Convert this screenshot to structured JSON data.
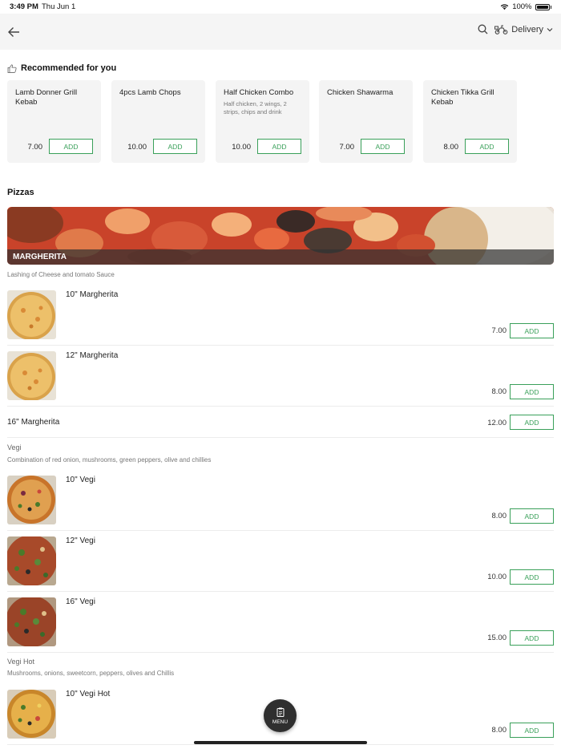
{
  "status_bar": {
    "time": "3:49 PM",
    "date": "Thu Jun 1",
    "battery": "100%"
  },
  "header": {
    "delivery_label": "Delivery"
  },
  "icons": {
    "back": "back-arrow-icon",
    "search": "search-icon",
    "delivery": "scooter-icon",
    "dropdown": "chevron-down-icon",
    "recommended": "thumbs-up-icon",
    "menu": "menu-clipboard-icon"
  },
  "colors": {
    "accent": "#3aa05a",
    "header_bg": "#f5f5f5",
    "card_bg": "#f4f4f4",
    "fab_bg": "#2f2f2f"
  },
  "recommended": {
    "title": "Recommended for you",
    "items": [
      {
        "name": "Lamb Donner Grill Kebab",
        "desc": "",
        "price": "7.00",
        "add": "ADD"
      },
      {
        "name": "4pcs Lamb Chops",
        "desc": "",
        "price": "10.00",
        "add": "ADD"
      },
      {
        "name": "Half Chicken Combo",
        "desc": "Half chicken, 2 wings, 2 strips, chips and drink",
        "price": "10.00",
        "add": "ADD"
      },
      {
        "name": "Chicken Shawarma",
        "desc": "",
        "price": "7.00",
        "add": "ADD"
      },
      {
        "name": "Chicken Tikka Grill Kebab",
        "desc": "",
        "price": "8.00",
        "add": "ADD"
      }
    ]
  },
  "pizzas": {
    "title": "Pizzas",
    "banner_label": "MARGHERITA",
    "margherita_desc": "Lashing of Cheese and tomato Sauce",
    "margherita_items": [
      {
        "name": "10\" Margherita",
        "price": "7.00",
        "add": "ADD"
      },
      {
        "name": "12\" Margherita",
        "price": "8.00",
        "add": "ADD"
      },
      {
        "name": "16\" Margherita",
        "price": "12.00",
        "add": "ADD"
      }
    ],
    "vegi_name": "Vegi",
    "vegi_desc": "Combination of red onion, mushrooms, green peppers, olive and chillies",
    "vegi_items": [
      {
        "name": "10\" Vegi",
        "price": "8.00",
        "add": "ADD"
      },
      {
        "name": "12\" Vegi",
        "price": "10.00",
        "add": "ADD"
      },
      {
        "name": "16\" Vegi",
        "price": "15.00",
        "add": "ADD"
      }
    ],
    "vegi_hot_name": "Vegi Hot",
    "vegi_hot_desc": "Mushrooms, onions, sweetcorn, peppers, olives and Chillis",
    "vegi_hot_items": [
      {
        "name": "10\" Vegi Hot",
        "price": "8.00",
        "add": "ADD"
      }
    ]
  },
  "fab": {
    "label": "MENU"
  }
}
